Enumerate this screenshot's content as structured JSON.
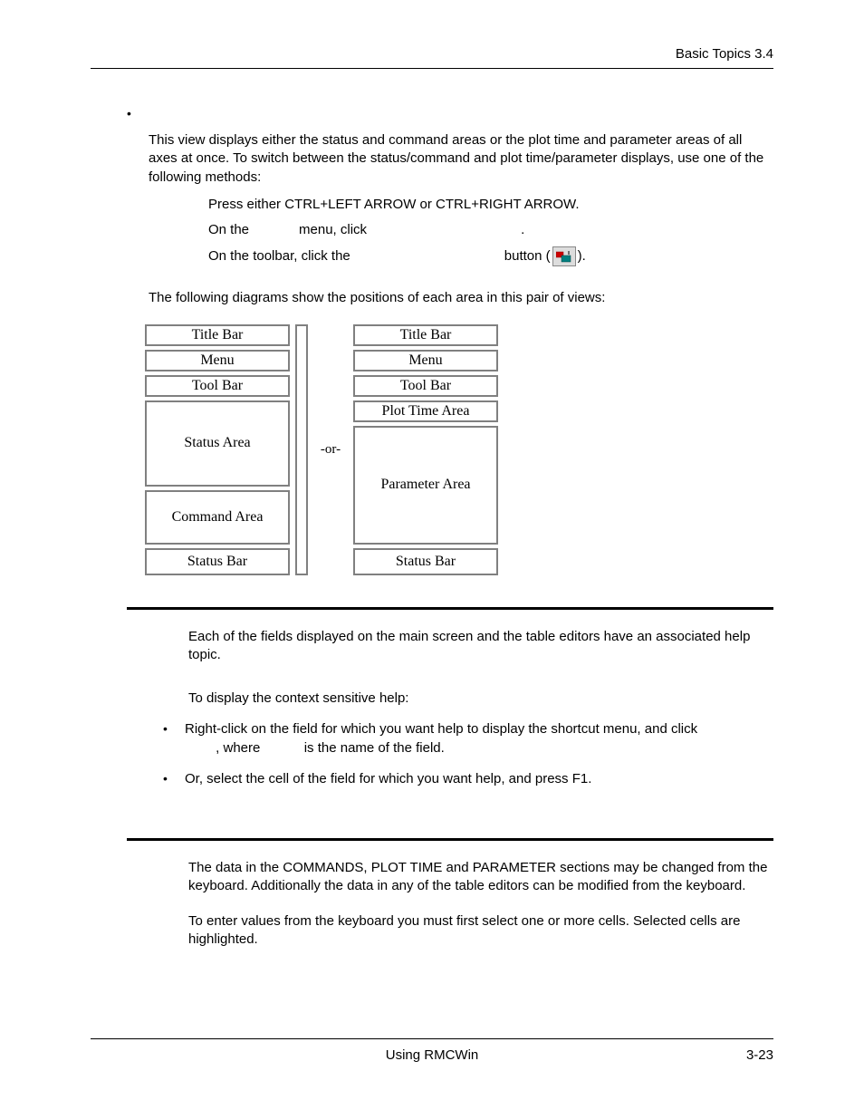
{
  "header": {
    "right_text": "Basic Topics  3.4"
  },
  "section1": {
    "p1": "This view displays either the status and command areas or the plot time and parameter areas of all axes at once. To switch between the status/command and plot time/parameter displays, use one of the following methods:",
    "s1": "Press either CTRL+LEFT ARROW or CTRL+RIGHT ARROW.",
    "s2a": "On the ",
    "s2b": " menu, click ",
    "s2c": " .",
    "s3a": "On the toolbar, click the ",
    "s3b": " button (",
    "s3c": ").",
    "p2": "The following diagrams show the positions of each area in this pair of views:"
  },
  "diagram": {
    "left": {
      "title": "Title Bar",
      "menu": "Menu",
      "tool": "Tool Bar",
      "area1": "Status Area",
      "area2": "Command Area",
      "status": "Status Bar"
    },
    "or": "-or-",
    "right": {
      "title": "Title Bar",
      "menu": "Menu",
      "tool": "Tool Bar",
      "area1": "Plot Time Area",
      "area2": "Parameter Area",
      "status": "Status Bar"
    }
  },
  "section2": {
    "p1": "Each of the fields displayed on the main screen and the table editors have an associated help topic.",
    "p2": "To display the context sensitive help:",
    "b1a": "Right-click on the field for which you want help to display the shortcut menu, and click ",
    "b1b": ", where ",
    "b1c": " is the name of the field.",
    "b2": "Or, select the cell of the field for which you want help, and press F1."
  },
  "section3": {
    "p1": "The data in the COMMANDS, PLOT TIME and PARAMETER sections may be changed from the keyboard. Additionally the data in any of the table editors can be modified from the keyboard.",
    "p2": "To enter values from the keyboard you must first select one or more cells. Selected cells are highlighted."
  },
  "footer": {
    "center": "Using RMCWin",
    "right": "3-23"
  }
}
